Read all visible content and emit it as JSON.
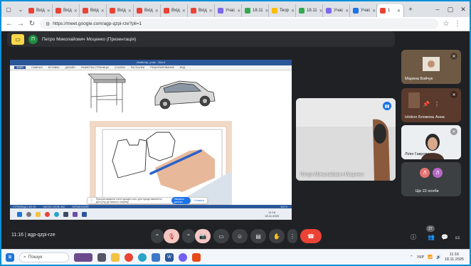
{
  "browser": {
    "tabs": [
      {
        "label": "Вхід",
        "color": "#ea4335"
      },
      {
        "label": "Вхід",
        "color": "#ea4335"
      },
      {
        "label": "Вхід",
        "color": "#ea4335"
      },
      {
        "label": "Вхід",
        "color": "#ea4335"
      },
      {
        "label": "Вхід",
        "color": "#ea4335"
      },
      {
        "label": "Вхід",
        "color": "#ea4335"
      },
      {
        "label": "Вхід",
        "color": "#ea4335"
      },
      {
        "label": "Учас",
        "color": "#7b68ee"
      },
      {
        "label": "18.11",
        "color": "#34a853"
      },
      {
        "label": "Teop",
        "color": "#fbbc04"
      },
      {
        "label": "18.11",
        "color": "#34a853"
      },
      {
        "label": "Учас",
        "color": "#7b68ee"
      },
      {
        "label": "Учас",
        "color": "#1a73e8"
      },
      {
        "label": "1",
        "color": "#ea4335"
      }
    ],
    "url": "https://meet.google.com/agp-qzpi-rze?pli=1"
  },
  "meet": {
    "presenter_avatar": "П",
    "presenter_title": "Петро Миколайович Моценко (Презентація)",
    "main_tile_name": "Петро Миколайович Моценко",
    "tiles": [
      {
        "name": "Марина Бойчук"
      },
      {
        "name": "Izlokon Бложонь Анна"
      },
      {
        "name": "Лілія Гаврова"
      },
      {
        "name": "Ще 22 особи",
        "avatars": [
          "Л",
          "Л"
        ]
      }
    ],
    "clock": "11:16",
    "meeting_code": "agp-qzpi-rze",
    "people_count": "27"
  },
  "shared_doc": {
    "window_title": "Майстер_клас - Word",
    "ribbon_tabs": [
      "ФАЙЛ",
      "ГЛАВНАЯ",
      "ВСТАВКА",
      "ДИЗАЙН",
      "РАЗМЕТКА СТРАНИЦЫ",
      "ССЫЛКИ",
      "РАССЫЛКИ",
      "РЕЦЕНЗИРОВАНИЕ",
      "ВИД"
    ],
    "status_left": "СТРАНИЦА 1 ИЗ 15",
    "status_words": "ЧИСЛО СЛОВ: 962",
    "status_lang": "УКРАИНСКИЙ",
    "zoom": "100 %",
    "inner_time": "11:16",
    "inner_date": "18.11.2025",
    "toast_text": "Пріоритизувати meet.google.com для представлення доступу до вашого екрану",
    "toast_button": "Закрити доступ",
    "toast_hide": "Сховати"
  },
  "taskbar": {
    "search_label": "Пошук",
    "lang": "УКР",
    "time": "11:16",
    "date": "18.11.2025"
  },
  "colors": {
    "accent": "#1a73e8",
    "hangup": "#ea4335",
    "meet_bg": "#202124"
  }
}
